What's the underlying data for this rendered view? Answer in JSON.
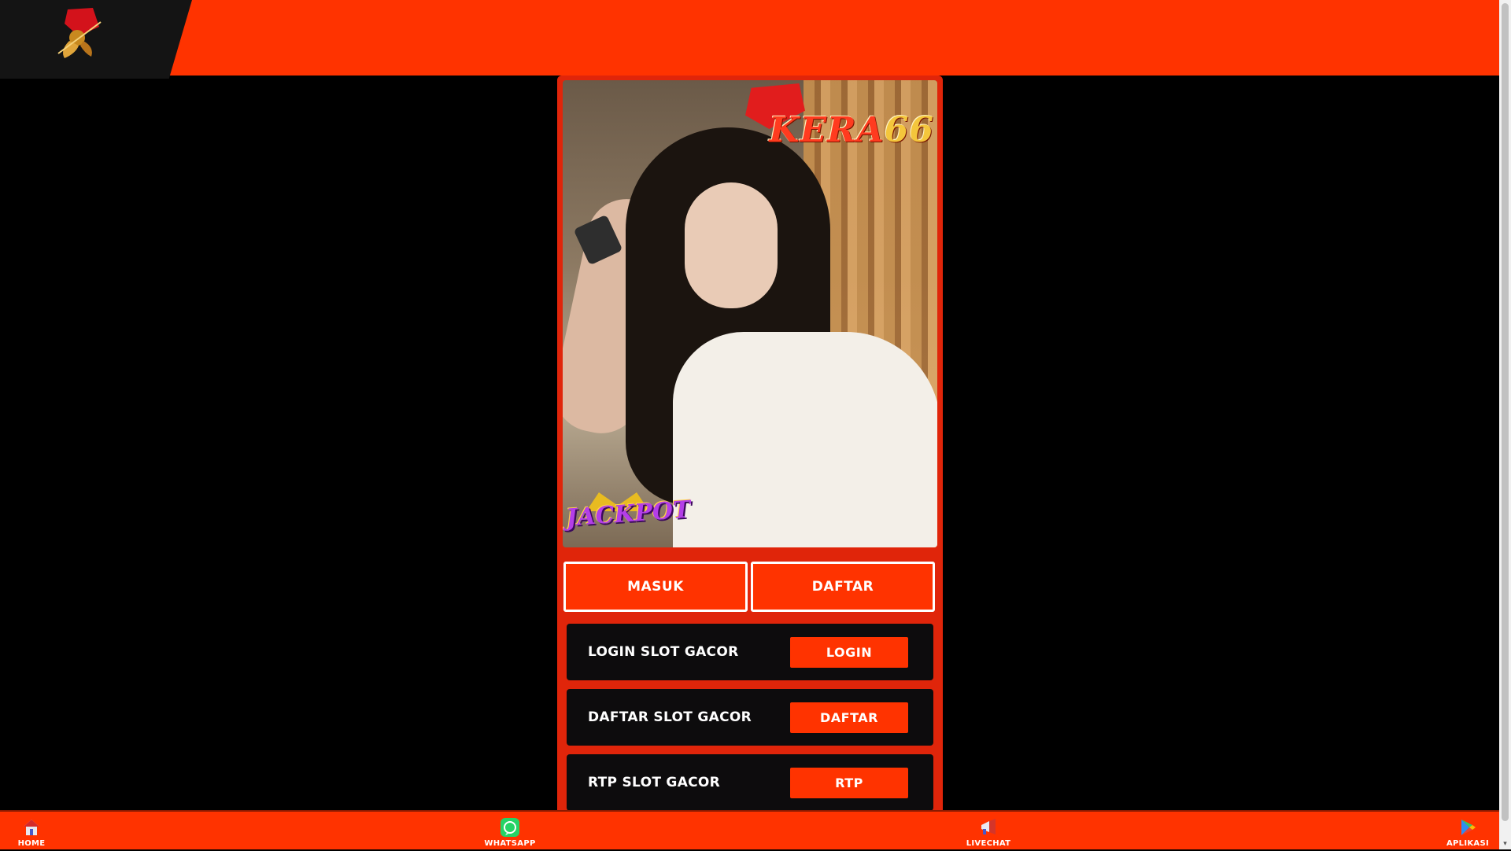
{
  "colors": {
    "accent": "#ff3300",
    "panel": "#e0250a",
    "card": "#0d0c0d",
    "background": "#000000"
  },
  "header": {
    "logo_icon": "monkey-king-logo"
  },
  "hero": {
    "brand_name": "KERA",
    "brand_number": "66",
    "jackpot_badge": "JACKPOT"
  },
  "auth": {
    "masuk_label": "MASUK",
    "daftar_label": "DAFTAR"
  },
  "cards": [
    {
      "title": "LOGIN SLOT GACOR",
      "button": "LOGIN"
    },
    {
      "title": "DAFTAR SLOT GACOR",
      "button": "DAFTAR"
    },
    {
      "title": "RTP SLOT GACOR",
      "button": "RTP"
    }
  ],
  "bottom_nav": [
    {
      "label": "HOME",
      "icon": "home-icon"
    },
    {
      "label": "WHATSAPP",
      "icon": "whatsapp-icon"
    },
    {
      "label": "LIVECHAT",
      "icon": "livechat-megaphone-icon"
    },
    {
      "label": "APLIKASI",
      "icon": "google-play-icon"
    }
  ]
}
